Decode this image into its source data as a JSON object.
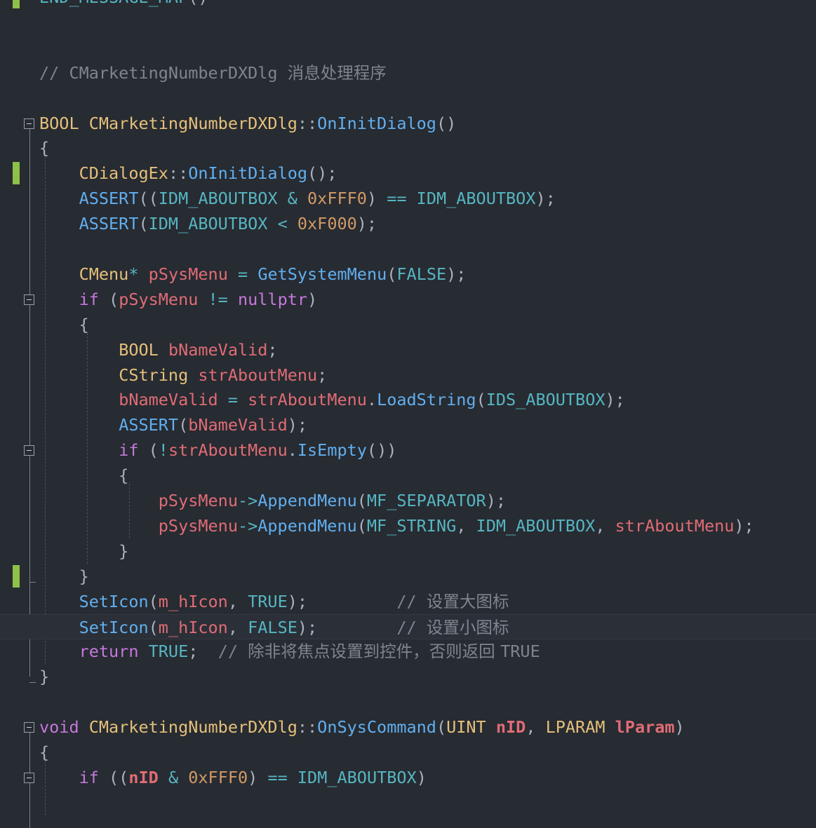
{
  "editor": {
    "lines": [
      {
        "tokens": [
          [
            "mac",
            "END_MESSAGE_MAP"
          ],
          [
            "pun",
            "()"
          ]
        ]
      },
      {
        "tokens": []
      },
      {
        "tokens": []
      },
      {
        "tokens": [
          [
            "cm",
            "// CMarketingNumberDXDlg "
          ],
          [
            "cmcj",
            "消息处理程序"
          ]
        ]
      },
      {
        "tokens": []
      },
      {
        "tokens": [
          [
            "ty",
            "BOOL "
          ],
          [
            "ty",
            "CMarketingNumberDXDlg"
          ],
          [
            "pun",
            "::"
          ],
          [
            "fn",
            "OnInitDialog"
          ],
          [
            "pun",
            "()"
          ]
        ]
      },
      {
        "tokens": [
          [
            "pun",
            "{"
          ]
        ]
      },
      {
        "tokens": [
          [
            "pun",
            "    "
          ],
          [
            "ty",
            "CDialogEx"
          ],
          [
            "pun",
            "::"
          ],
          [
            "fn",
            "OnInitDialog"
          ],
          [
            "pun",
            "();"
          ]
        ]
      },
      {
        "tokens": [
          [
            "pun",
            "    "
          ],
          [
            "fn",
            "ASSERT"
          ],
          [
            "pun",
            "(("
          ],
          [
            "mac",
            "IDM_ABOUTBOX"
          ],
          [
            "pun",
            " "
          ],
          [
            "op",
            "&"
          ],
          [
            "pun",
            " "
          ],
          [
            "num",
            "0xFFF0"
          ],
          [
            "pun",
            ") "
          ],
          [
            "op",
            "=="
          ],
          [
            "pun",
            " "
          ],
          [
            "mac",
            "IDM_ABOUTBOX"
          ],
          [
            "pun",
            ");"
          ]
        ]
      },
      {
        "tokens": [
          [
            "pun",
            "    "
          ],
          [
            "fn",
            "ASSERT"
          ],
          [
            "pun",
            "("
          ],
          [
            "mac",
            "IDM_ABOUTBOX"
          ],
          [
            "pun",
            " "
          ],
          [
            "op",
            "<"
          ],
          [
            "pun",
            " "
          ],
          [
            "num",
            "0xF000"
          ],
          [
            "pun",
            ");"
          ]
        ]
      },
      {
        "tokens": []
      },
      {
        "tokens": [
          [
            "pun",
            "    "
          ],
          [
            "ty",
            "CMenu"
          ],
          [
            "op",
            "*"
          ],
          [
            "pun",
            " "
          ],
          [
            "var",
            "pSysMenu"
          ],
          [
            "pun",
            " "
          ],
          [
            "op",
            "="
          ],
          [
            "pun",
            " "
          ],
          [
            "fn",
            "GetSystemMenu"
          ],
          [
            "pun",
            "("
          ],
          [
            "mac",
            "FALSE"
          ],
          [
            "pun",
            ");"
          ]
        ]
      },
      {
        "tokens": [
          [
            "pun",
            "    "
          ],
          [
            "kw",
            "if"
          ],
          [
            "pun",
            " ("
          ],
          [
            "var",
            "pSysMenu"
          ],
          [
            "pun",
            " "
          ],
          [
            "op",
            "!="
          ],
          [
            "pun",
            " "
          ],
          [
            "kw",
            "nullptr"
          ],
          [
            "pun",
            ")"
          ]
        ]
      },
      {
        "tokens": [
          [
            "pun",
            "    {"
          ]
        ]
      },
      {
        "tokens": [
          [
            "pun",
            "        "
          ],
          [
            "ty",
            "BOOL "
          ],
          [
            "var",
            "bNameValid"
          ],
          [
            "pun",
            ";"
          ]
        ]
      },
      {
        "tokens": [
          [
            "pun",
            "        "
          ],
          [
            "ty",
            "CString "
          ],
          [
            "var",
            "strAboutMenu"
          ],
          [
            "pun",
            ";"
          ]
        ]
      },
      {
        "tokens": [
          [
            "pun",
            "        "
          ],
          [
            "var",
            "bNameValid"
          ],
          [
            "pun",
            " "
          ],
          [
            "op",
            "="
          ],
          [
            "pun",
            " "
          ],
          [
            "var",
            "strAboutMenu"
          ],
          [
            "pun",
            "."
          ],
          [
            "fn",
            "LoadString"
          ],
          [
            "pun",
            "("
          ],
          [
            "mac",
            "IDS_ABOUTBOX"
          ],
          [
            "pun",
            ");"
          ]
        ]
      },
      {
        "tokens": [
          [
            "pun",
            "        "
          ],
          [
            "fn",
            "ASSERT"
          ],
          [
            "pun",
            "("
          ],
          [
            "var",
            "bNameValid"
          ],
          [
            "pun",
            ");"
          ]
        ]
      },
      {
        "tokens": [
          [
            "pun",
            "        "
          ],
          [
            "kw",
            "if"
          ],
          [
            "pun",
            " ("
          ],
          [
            "op",
            "!"
          ],
          [
            "var",
            "strAboutMenu"
          ],
          [
            "pun",
            "."
          ],
          [
            "fn",
            "IsEmpty"
          ],
          [
            "pun",
            "())"
          ]
        ]
      },
      {
        "tokens": [
          [
            "pun",
            "        {"
          ]
        ]
      },
      {
        "tokens": [
          [
            "pun",
            "            "
          ],
          [
            "var",
            "pSysMenu"
          ],
          [
            "op",
            "->"
          ],
          [
            "fn",
            "AppendMenu"
          ],
          [
            "pun",
            "("
          ],
          [
            "mac",
            "MF_SEPARATOR"
          ],
          [
            "pun",
            ");"
          ]
        ]
      },
      {
        "tokens": [
          [
            "pun",
            "            "
          ],
          [
            "var",
            "pSysMenu"
          ],
          [
            "op",
            "->"
          ],
          [
            "fn",
            "AppendMenu"
          ],
          [
            "pun",
            "("
          ],
          [
            "mac",
            "MF_STRING"
          ],
          [
            "pun",
            ", "
          ],
          [
            "mac",
            "IDM_ABOUTBOX"
          ],
          [
            "pun",
            ", "
          ],
          [
            "var",
            "strAboutMenu"
          ],
          [
            "pun",
            ");"
          ]
        ]
      },
      {
        "tokens": [
          [
            "pun",
            "        }"
          ]
        ]
      },
      {
        "tokens": [
          [
            "pun",
            "    }"
          ]
        ]
      },
      {
        "tokens": [
          [
            "pun",
            "    "
          ],
          [
            "fn",
            "SetIcon"
          ],
          [
            "pun",
            "("
          ],
          [
            "var",
            "m_hIcon"
          ],
          [
            "pun",
            ", "
          ],
          [
            "mac",
            "TRUE"
          ],
          [
            "pun",
            ");"
          ],
          [
            "pun",
            "         "
          ],
          [
            "cm",
            "// "
          ],
          [
            "cmcj",
            "设置大图标"
          ]
        ]
      },
      {
        "tokens": [
          [
            "pun",
            "    "
          ],
          [
            "fn",
            "SetIcon"
          ],
          [
            "pun",
            "("
          ],
          [
            "var",
            "m_hIcon"
          ],
          [
            "pun",
            ", "
          ],
          [
            "mac",
            "FALSE"
          ],
          [
            "pun",
            ");"
          ],
          [
            "pun",
            "        "
          ],
          [
            "cm",
            "// "
          ],
          [
            "cmcj",
            "设置小图标"
          ]
        ]
      },
      {
        "tokens": [
          [
            "pun",
            "    "
          ],
          [
            "kw",
            "return"
          ],
          [
            "pun",
            " "
          ],
          [
            "mac",
            "TRUE"
          ],
          [
            "pun",
            ";  "
          ],
          [
            "cm",
            "// "
          ],
          [
            "cmcj",
            "除非将焦点设置到控件，否则返回 "
          ],
          [
            "cm",
            "TRUE"
          ]
        ]
      },
      {
        "tokens": [
          [
            "pun",
            "}"
          ]
        ]
      },
      {
        "tokens": []
      },
      {
        "tokens": [
          [
            "kw",
            "void"
          ],
          [
            "pun",
            " "
          ],
          [
            "ty",
            "CMarketingNumberDXDlg"
          ],
          [
            "pun",
            "::"
          ],
          [
            "fn",
            "OnSysCommand"
          ],
          [
            "pun",
            "("
          ],
          [
            "ty",
            "UINT "
          ],
          [
            "par",
            "nID"
          ],
          [
            "pun",
            ", "
          ],
          [
            "ty",
            "LPARAM "
          ],
          [
            "par",
            "lParam"
          ],
          [
            "pun",
            ")"
          ]
        ]
      },
      {
        "tokens": [
          [
            "pun",
            "{"
          ]
        ]
      },
      {
        "tokens": [
          [
            "pun",
            "    "
          ],
          [
            "kw",
            "if"
          ],
          [
            "pun",
            " (("
          ],
          [
            "par",
            "nID"
          ],
          [
            "pun",
            " "
          ],
          [
            "op",
            "&"
          ],
          [
            "pun",
            " "
          ],
          [
            "num",
            "0xFFF0"
          ],
          [
            "pun",
            ") "
          ],
          [
            "op",
            "=="
          ],
          [
            "pun",
            " "
          ],
          [
            "mac",
            "IDM_ABOUTBOX"
          ],
          [
            "pun",
            ")"
          ]
        ]
      }
    ],
    "current_line": 25,
    "change_marks": [
      0,
      7,
      23,
      25
    ],
    "fold_boxes": [
      5,
      12,
      18,
      29,
      31
    ]
  }
}
